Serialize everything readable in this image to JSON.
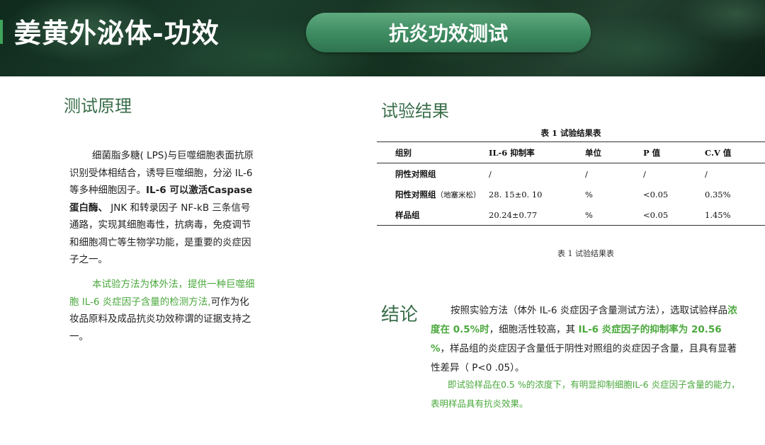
{
  "header": {
    "title": "姜黄外泌体-功效",
    "section_pill": "抗炎功效测试"
  },
  "principle": {
    "heading": "测试原理",
    "para1": {
      "normal1": "细菌脂多糖( LPS)与巨噬细胞表面抗原识别受体相结合，诱导巨噬细胞，分泌 IL-6 等多种细胞因子。",
      "bold1": "IL-6 可以激活Caspase蛋白酶、",
      "normal2": " JNK 和转录因子 NF-kB 三条信号通路，实现其细胞毒性，抗病毒，免疫调节和细胞凋亡等生物学功能，是重要的炎症因子之一。"
    },
    "para2": {
      "green": "本试验方法为体外法，提供一种巨噬细胞 IL-6 炎症因子含量的检测方法,",
      "normal": "可作为化妆品原料及成品抗炎功效称谓的证据支持之一。"
    }
  },
  "results": {
    "heading": "试验结果",
    "table_title": "表 1  试验结果表",
    "columns": [
      "组别",
      "IL-6 抑制率",
      "单位",
      "P 值",
      "C.V 值"
    ],
    "rows": [
      {
        "group": "阴性对照组",
        "group_note": "",
        "rate": "/",
        "unit": "/",
        "p": "/",
        "cv": "/"
      },
      {
        "group": "阳性对照组",
        "group_note": "（地塞米松）",
        "rate": "28. 15±0. 10",
        "unit": "%",
        "p": "<0.05",
        "cv": "0.35%"
      },
      {
        "group": "样品组",
        "group_note": "",
        "rate": "20.24±0.77",
        "unit": "%",
        "p": "<0.05",
        "cv": "1.45%"
      }
    ],
    "caption": "表 1  试验结果表"
  },
  "conclusion": {
    "heading": "结论",
    "para1": {
      "t1": "按照实验方法（体外 IL-6 炎症因子含量测试方法），选取试验样品",
      "g1": "浓度在 0.5%时",
      "t2": "，细胞活性较高，其 ",
      "g2": "IL-6 炎症因子的抑制率为 20.56 %",
      "t3": "，样品组的炎症因子含量低于阴性对照组的炎症因子含量，且具有显著性差异（ P<0 .05）。"
    },
    "para2": "即试验样品在0.5 %的浓度下，有明显抑制细胞IL-6 炎症因子含量的能力，表明样品具有抗炎效果。"
  }
}
